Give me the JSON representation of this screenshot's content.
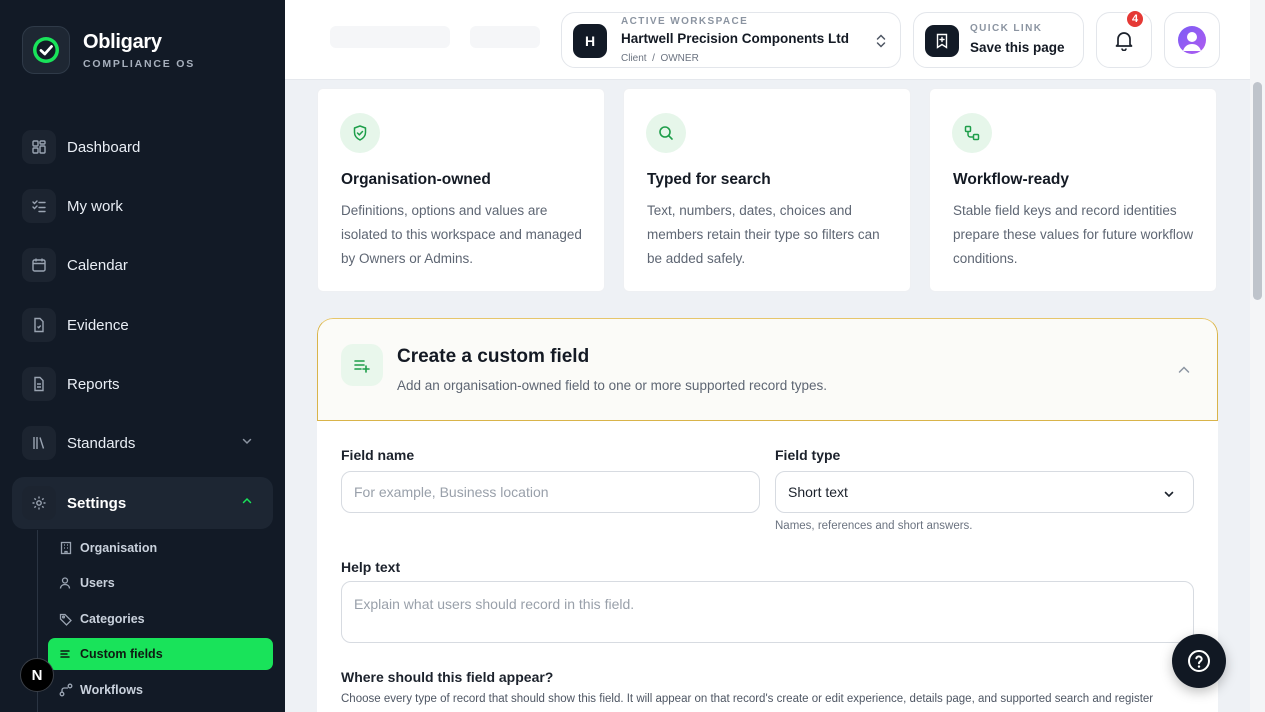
{
  "brand": {
    "name": "Obligary",
    "tagline": "COMPLIANCE OS"
  },
  "nav": {
    "items": [
      {
        "label": "Dashboard",
        "icon": "grid-icon"
      },
      {
        "label": "My work",
        "icon": "checklist-icon"
      },
      {
        "label": "Calendar",
        "icon": "calendar-icon"
      },
      {
        "label": "Evidence",
        "icon": "document-icon"
      },
      {
        "label": "Reports",
        "icon": "report-icon"
      },
      {
        "label": "Standards",
        "icon": "library-icon"
      },
      {
        "label": "Settings",
        "icon": "gear-icon"
      }
    ],
    "settings_sub": [
      {
        "label": "Organisation",
        "icon": "building-icon"
      },
      {
        "label": "Users",
        "icon": "user-icon"
      },
      {
        "label": "Categories",
        "icon": "tag-icon"
      },
      {
        "label": "Custom fields",
        "icon": "list-icon"
      },
      {
        "label": "Workflows",
        "icon": "workflow-icon"
      }
    ],
    "avatar_letter": "N"
  },
  "workspace": {
    "kicker": "ACTIVE WORKSPACE",
    "initial": "H",
    "name": "Hartwell Precision Components Ltd",
    "meta": "Client  /  OWNER"
  },
  "quick_link": {
    "kicker": "QUICK LINK",
    "label": "Save this page"
  },
  "notifications": {
    "count": "4"
  },
  "features": [
    {
      "title": "Organisation-owned",
      "body": "Definitions, options and values are isolated to this workspace and managed by Owners or Admins.",
      "icon": "shield-check-icon"
    },
    {
      "title": "Typed for search",
      "body": "Text, numbers, dates, choices and members retain their type so filters can be added safely.",
      "icon": "search-icon"
    },
    {
      "title": "Workflow-ready",
      "body": "Stable field keys and record identities prepare these values for future workflow conditions.",
      "icon": "workflow-icon"
    }
  ],
  "form": {
    "title": "Create a custom field",
    "subtitle": "Add an organisation-owned field to one or more supported record types.",
    "field_name_label": "Field name",
    "field_name_placeholder": "For example, Business location",
    "field_type_label": "Field type",
    "field_type_value": "Short text",
    "field_type_hint": "Names, references and short answers.",
    "help_text_label": "Help text",
    "help_text_placeholder": "Explain what users should record in this field.",
    "appear_label": "Where should this field appear?",
    "appear_desc": "Choose every type of record that should show this field. It will appear on that record's create or edit experience, details page, and supported search and register"
  },
  "colors": {
    "accent": "#19e35a",
    "sidebar": "#121a26",
    "highlight_border": "#d9b44a",
    "badge": "#e53935"
  }
}
